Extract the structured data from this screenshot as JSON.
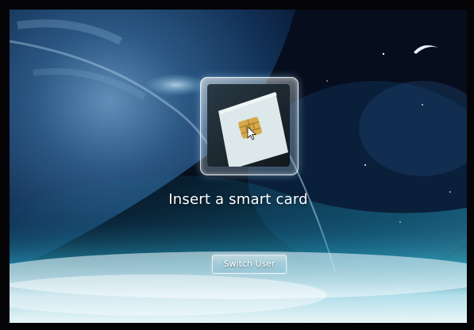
{
  "login_screen": {
    "prompt_text": "Insert a smart card",
    "switch_user_label": "Switch User"
  },
  "icons": {
    "tile": "smart-card-icon",
    "pointer": "mouse-pointer-icon"
  },
  "colors": {
    "text": "#ffffff",
    "chip_gold": "#d7a84a",
    "card_face": "#dce8ea",
    "atmosphere_glow": "#bfe9f4"
  }
}
